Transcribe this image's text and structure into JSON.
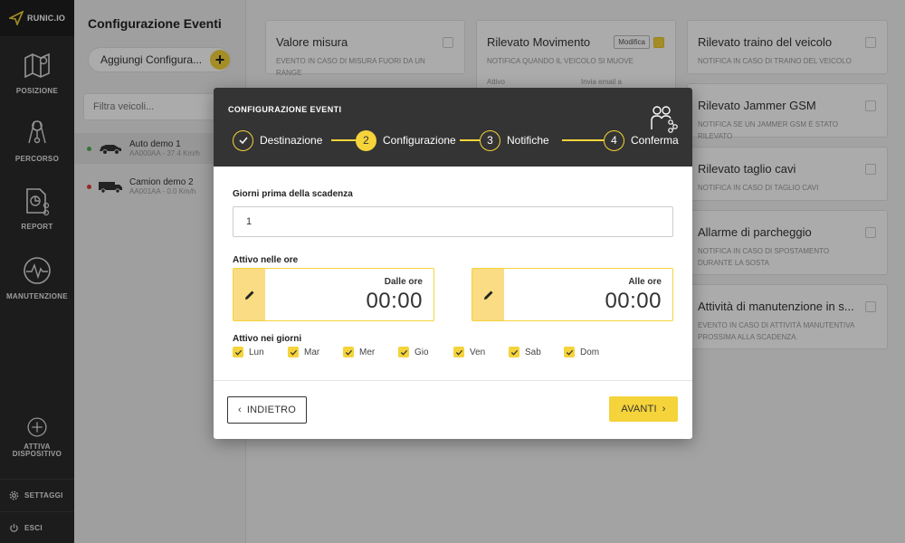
{
  "nav": {
    "brand": "RUNIC.IO",
    "items": [
      {
        "label": "POSIZIONE",
        "icon": "map-icon"
      },
      {
        "label": "PERCORSO",
        "icon": "route-icon"
      },
      {
        "label": "REPORT",
        "icon": "report-icon"
      },
      {
        "label": "MANUTENZIONE",
        "icon": "maintenance-icon"
      }
    ],
    "activate": {
      "line1": "ATTIVA",
      "line2": "DISPOSITIVO"
    },
    "settings": "SETTAGGI",
    "logout": "ESCI"
  },
  "panel": {
    "title": "Configurazione Eventi",
    "add_label": "Aggiungi Configura...",
    "filter_placeholder": "Filtra veicoli...",
    "vehicles": [
      {
        "name": "Auto demo 1",
        "sub": "AA000AA - 37.4 Km/h",
        "status_color": "#4caf50"
      },
      {
        "name": "Camion demo 2",
        "sub": "AA001AA - 0.0 Km/h",
        "status_color": "#e53935"
      }
    ]
  },
  "cards": [
    {
      "title": "Valore misura",
      "desc": "EVENTO IN CASO DI MISURA FUORI DA UN RANGE"
    },
    {
      "title": "Rilevato Movimento",
      "desc": "NOTIFICA QUANDO IL VEICOLO SI MUOVE",
      "badge": "Modifica",
      "extra1": "Attivo",
      "extra2": "Invia email a"
    },
    {
      "title": "Rilevato traino del veicolo",
      "desc": "NOTIFICA IN CASO DI TRAINO DEL VEICOLO"
    },
    {
      "title": "Rilevato Jammer GSM",
      "desc": "NOTIFICA SE UN JAMMER GSM È STATO RILEVATO"
    },
    {
      "title": "Rilevato taglio cavi",
      "desc": "NOTIFICA IN CASO DI TAGLIO CAVI"
    },
    {
      "title": "Allarme di parcheggio",
      "desc": "NOTIFICA IN CASO DI SPOSTAMENTO DURANTE LA SOSTA"
    },
    {
      "title": "Attività di manutenzione in s...",
      "desc": "EVENTO IN CASO DI ATTIVITÀ MANUTENTIVA PROSSIMA ALLA SCADENZA."
    }
  ],
  "modal": {
    "title": "CONFIGURAZIONE EVENTI",
    "steps": [
      {
        "num": "✓",
        "label": "Destinazione"
      },
      {
        "num": "2",
        "label": "Configurazione"
      },
      {
        "num": "3",
        "label": "Notifiche"
      },
      {
        "num": "4",
        "label": "Conferma"
      }
    ],
    "days_before_label": "Giorni prima della scadenza",
    "days_before_value": "1",
    "hours_label": "Attivo nelle ore",
    "from": {
      "label": "Dalle ore",
      "value": "00:00"
    },
    "to": {
      "label": "Alle ore",
      "value": "00:00"
    },
    "days_label": "Attivo nei giorni",
    "days": [
      "Lun",
      "Mar",
      "Mer",
      "Gio",
      "Ven",
      "Sab",
      "Dom"
    ],
    "back_label": "INDIETRO",
    "next_label": "AVANTI"
  },
  "colors": {
    "accent": "#f5d33a",
    "header": "#343434",
    "nav": "#2b2b2b"
  }
}
